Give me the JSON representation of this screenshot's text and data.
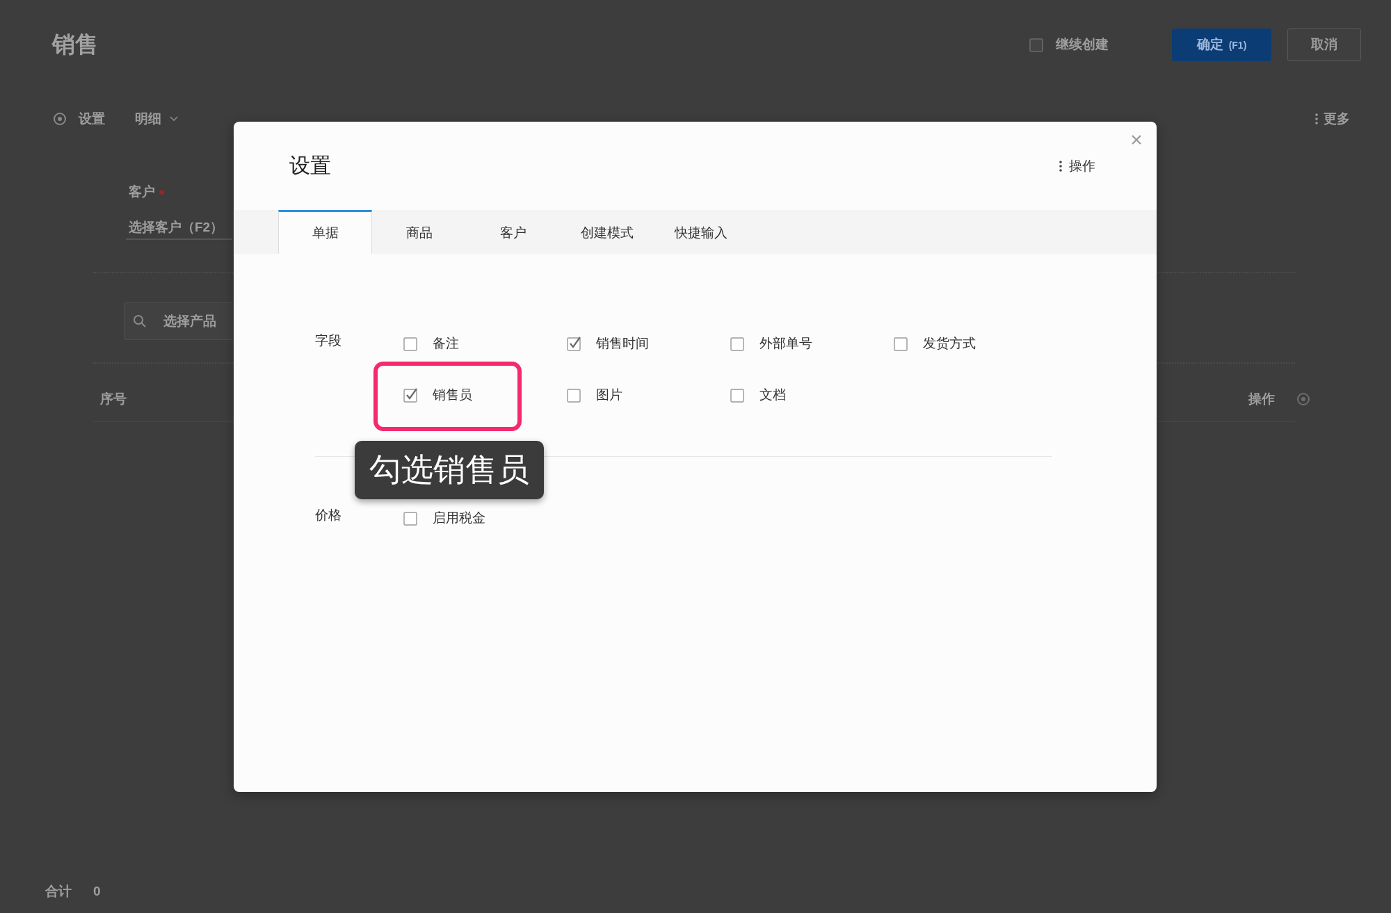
{
  "page": {
    "title": "销售",
    "continue_create": {
      "label": "继续创建",
      "checked": false
    },
    "buttons": [
      {
        "kind": "primary",
        "label": "确定",
        "shortcut": "(F1)"
      },
      {
        "kind": "default",
        "label": "取消"
      }
    ],
    "toolbar": {
      "settings": "设置",
      "view": "明细",
      "more": "更多"
    },
    "customer": {
      "label": "客户",
      "required": true,
      "placeholder": "选择客户（F2）"
    },
    "product_search": {
      "placeholder": "选择产品"
    },
    "table": {
      "columns": [
        {
          "label": "序号"
        },
        {
          "label": "操作"
        }
      ]
    },
    "total": {
      "label": "合计",
      "value": "0"
    }
  },
  "dialog": {
    "title": "设置",
    "menu_label": "操作",
    "tabs": [
      {
        "label": "单据",
        "selected": true
      },
      {
        "label": "商品",
        "selected": false
      },
      {
        "label": "客户",
        "selected": false
      },
      {
        "label": "创建模式",
        "selected": false
      },
      {
        "label": "快捷输入",
        "selected": false
      }
    ],
    "sections": [
      {
        "label": "字段",
        "options": [
          {
            "label": "备注",
            "checked": false,
            "highlighted": false
          },
          {
            "label": "销售时间",
            "checked": true,
            "highlighted": false
          },
          {
            "label": "外部单号",
            "checked": false,
            "highlighted": false
          },
          {
            "label": "发货方式",
            "checked": false,
            "highlighted": false
          },
          {
            "label": "销售员",
            "checked": true,
            "highlighted": true
          },
          {
            "label": "图片",
            "checked": false,
            "highlighted": false
          },
          {
            "label": "文档",
            "checked": false,
            "highlighted": false
          }
        ]
      },
      {
        "label": "价格",
        "options": [
          {
            "label": "启用税金",
            "checked": false,
            "highlighted": false
          }
        ]
      }
    ]
  },
  "annotation": {
    "callout": "勾选销售员"
  }
}
